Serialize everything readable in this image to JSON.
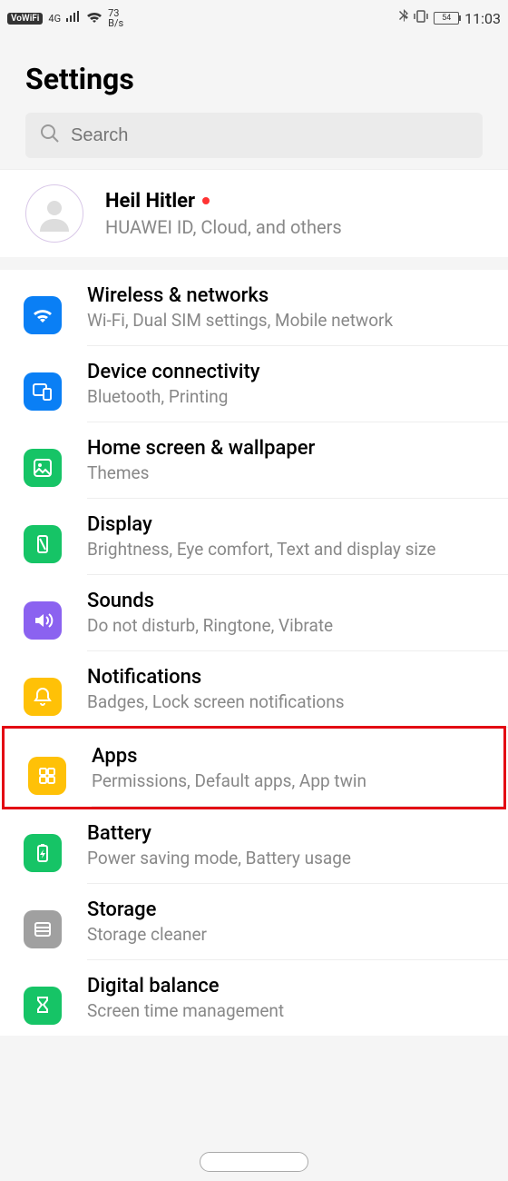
{
  "status": {
    "vowifi": "VoWiFi",
    "network": "4G",
    "speed_top": "73",
    "speed_bot": "B/s",
    "battery": "54",
    "time": "11:03"
  },
  "header": {
    "title": "Settings"
  },
  "search": {
    "placeholder": "Search"
  },
  "profile": {
    "name": "Heil Hitler",
    "sub": "HUAWEI ID, Cloud, and others"
  },
  "items": [
    {
      "title": "Wireless & networks",
      "sub": "Wi-Fi, Dual SIM settings, Mobile network",
      "icon": "wifi",
      "color": "ic-blue"
    },
    {
      "title": "Device connectivity",
      "sub": "Bluetooth, Printing",
      "icon": "device",
      "color": "ic-blue2"
    },
    {
      "title": "Home screen & wallpaper",
      "sub": "Themes",
      "icon": "wallpaper",
      "color": "ic-green"
    },
    {
      "title": "Display",
      "sub": "Brightness, Eye comfort, Text and display size",
      "icon": "display",
      "color": "ic-green"
    },
    {
      "title": "Sounds",
      "sub": "Do not disturb, Ringtone, Vibrate",
      "icon": "sound",
      "color": "ic-purple"
    },
    {
      "title": "Notifications",
      "sub": "Badges, Lock screen notifications",
      "icon": "bell",
      "color": "ic-orange"
    },
    {
      "title": "Apps",
      "sub": "Permissions, Default apps, App twin",
      "icon": "apps",
      "color": "ic-orange",
      "highlight": true
    },
    {
      "title": "Battery",
      "sub": "Power saving mode, Battery usage",
      "icon": "battery",
      "color": "ic-green"
    },
    {
      "title": "Storage",
      "sub": "Storage cleaner",
      "icon": "storage",
      "color": "ic-gray"
    },
    {
      "title": "Digital balance",
      "sub": "Screen time management",
      "icon": "hourglass",
      "color": "ic-green"
    }
  ]
}
